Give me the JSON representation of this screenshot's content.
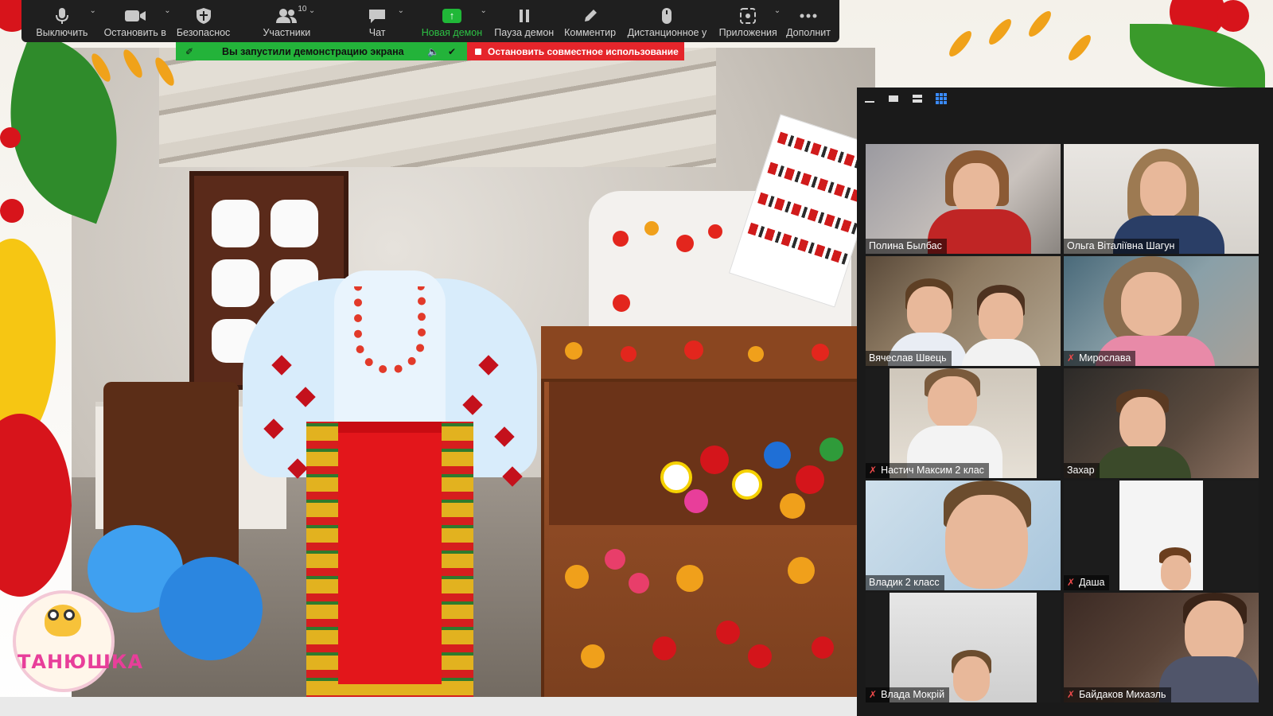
{
  "toolbar": {
    "items": [
      {
        "label": "Выключить",
        "icon": "mic-icon",
        "caret": true
      },
      {
        "label": "Остановить в",
        "icon": "video-camera-icon",
        "caret": true
      },
      {
        "label": "Безопаснос",
        "icon": "shield-icon",
        "caret": false
      },
      {
        "label": "Участники",
        "icon": "participants-icon",
        "caret": true,
        "badge": "10"
      },
      {
        "label": "Чат",
        "icon": "chat-icon",
        "caret": true
      },
      {
        "label": "Новая демон",
        "icon": "share-screen-icon",
        "caret": true,
        "active": true
      },
      {
        "label": "Пауза демон",
        "icon": "pause-icon",
        "caret": false
      },
      {
        "label": "Комментир",
        "icon": "pencil-icon",
        "caret": false
      },
      {
        "label": "Дистанционное у",
        "icon": "mouse-icon",
        "caret": false
      },
      {
        "label": "Приложения",
        "icon": "apps-icon",
        "caret": true
      },
      {
        "label": "Дополнит",
        "icon": "more-icon",
        "caret": false
      }
    ]
  },
  "share_banner": {
    "text": "Вы запустили демонстрацию экрана",
    "stop_label": "Остановить совместное использование"
  },
  "slide": {
    "logo_text": "ТАНЮШКА"
  },
  "gallery": {
    "participants": [
      {
        "name": "Полина Былбас",
        "muted": false,
        "active": false
      },
      {
        "name": "Ольга Віталіївна Шагун",
        "muted": false,
        "active": false
      },
      {
        "name": "Вячеслав Швець",
        "muted": false,
        "active": false
      },
      {
        "name": "Мирослава",
        "muted": true,
        "active": false
      },
      {
        "name": "Настич Максим 2 клас",
        "muted": true,
        "active": false
      },
      {
        "name": "Захар",
        "muted": false,
        "active": true
      },
      {
        "name": "Владик 2 класс",
        "muted": false,
        "active": false
      },
      {
        "name": "Даша",
        "muted": true,
        "active": false
      },
      {
        "name": "Влада Мокрій",
        "muted": true,
        "active": false
      },
      {
        "name": "Байдаков Михаэль",
        "muted": true,
        "active": false
      }
    ]
  },
  "colors": {
    "toolbar_bg": "#1f1f1f",
    "share_green": "#23b33a",
    "stop_red": "#e5252b",
    "active_speaker": "#c9d82e"
  }
}
